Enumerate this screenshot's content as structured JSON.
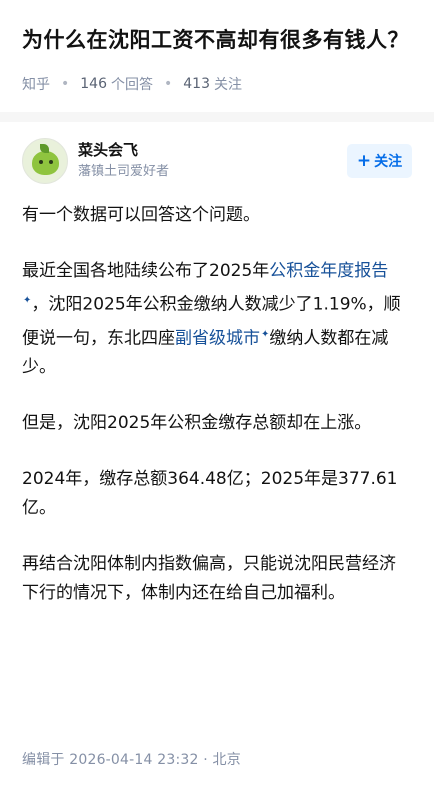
{
  "question": {
    "title": "为什么在沈阳工资不高却有很多有钱人？",
    "source": "知乎",
    "answer_count": "146",
    "answer_count_label": "个回答",
    "follower_count": "413",
    "follower_count_label": "关注"
  },
  "answer": {
    "author_name": "菜头会飞",
    "author_bio": "藩镇土司爱好者",
    "follow_label": "关注",
    "paragraphs": {
      "p1": "有一个数据可以回答这个问题。",
      "p2_a": "最近全国各地陆续公布了2025年",
      "p2_link1": "公积金年度报告",
      "p2_b": "，沈阳2025年公积金缴纳人数减少了1.19%，顺便说一句，东北四座",
      "p2_link2": "副省级城市",
      "p2_c": "缴纳人数都在减少。",
      "p3": "但是，沈阳2025年公积金缴存总额却在上涨。",
      "p4": "2024年，缴存总额364.48亿；2025年是377.61亿。",
      "p5": "再结合沈阳体制内指数偏高，只能说沈阳民营经济下行的情况下，体制内还在给自己加福利。"
    },
    "edit_info": "编辑于 2026-04-14 23:32 · 北京"
  },
  "colors": {
    "link": "#175199",
    "follow_text": "#056de8",
    "follow_bg": "#ebf5ff",
    "meta_gray": "#8590a6"
  }
}
